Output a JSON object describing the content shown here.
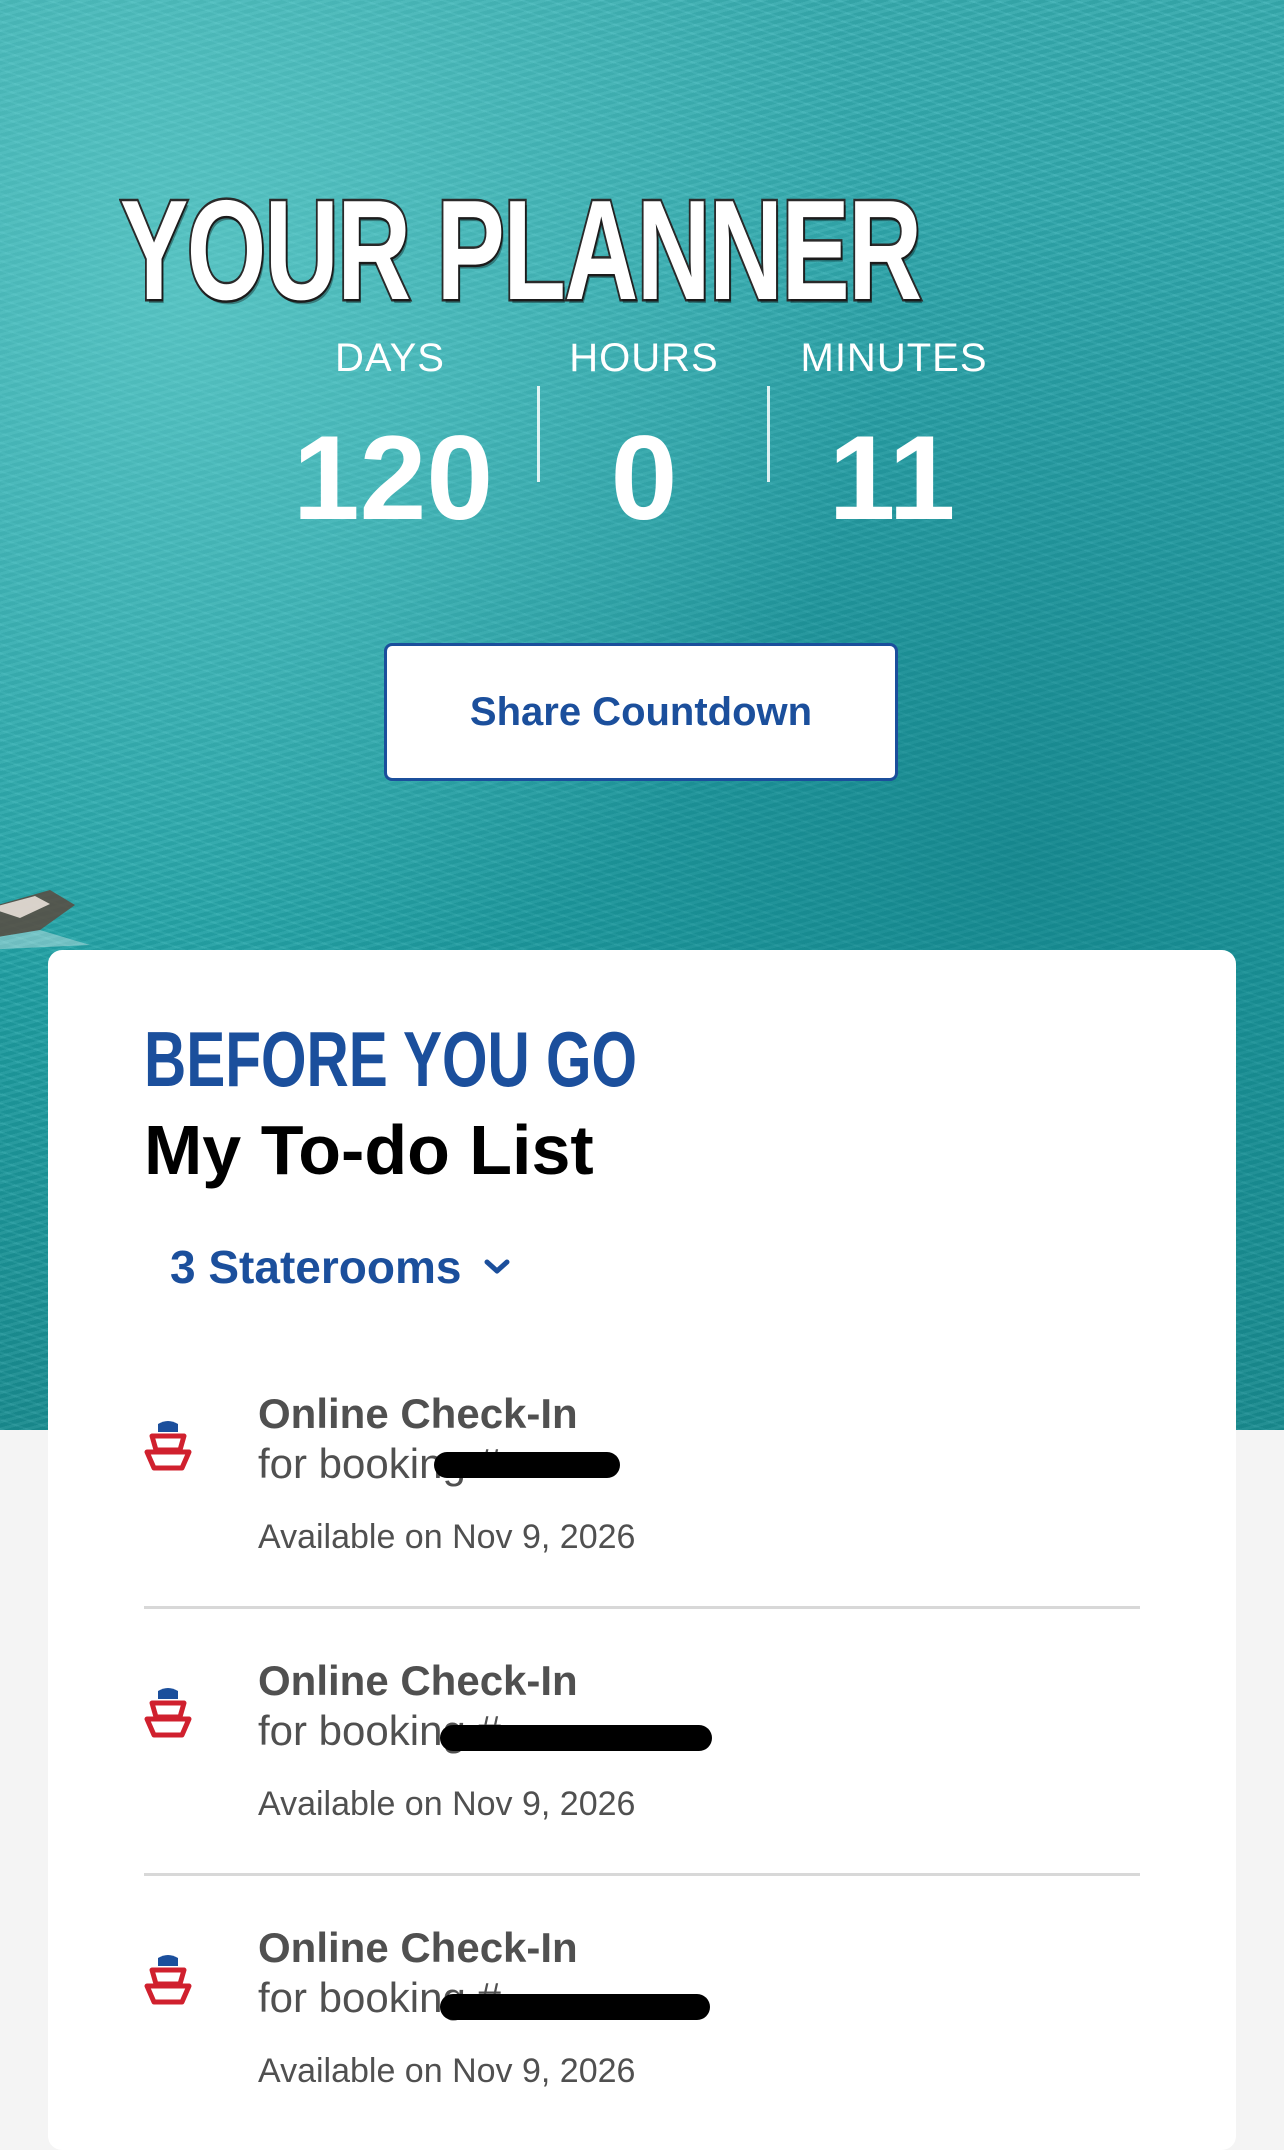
{
  "header": {
    "title": "YOUR PLANNER"
  },
  "countdown": {
    "days_label": "DAYS",
    "hours_label": "HOURS",
    "minutes_label": "MINUTES",
    "days": "120",
    "hours": "0",
    "minutes": "11",
    "share_label": "Share Countdown"
  },
  "todo": {
    "eyebrow": "BEFORE YOU GO",
    "title": "My To-do List",
    "staterooms_label": "3 Staterooms",
    "items": [
      {
        "title": "Online Check-In",
        "subtitle": "for booking #",
        "available": "Available on Nov 9, 2026",
        "icon": "cruise-ship-icon"
      },
      {
        "title": "Online Check-In",
        "subtitle": "for booking #",
        "available": "Available on Nov 9, 2026",
        "icon": "cruise-ship-icon"
      },
      {
        "title": "Online Check-In",
        "subtitle": "for booking #",
        "available": "Available on Nov 9, 2026",
        "icon": "cruise-ship-icon"
      }
    ]
  },
  "colors": {
    "brand_blue": "#1b4f9c",
    "icon_red": "#d0202e",
    "icon_blue": "#1b4f9c",
    "water": "#20a3a7"
  }
}
